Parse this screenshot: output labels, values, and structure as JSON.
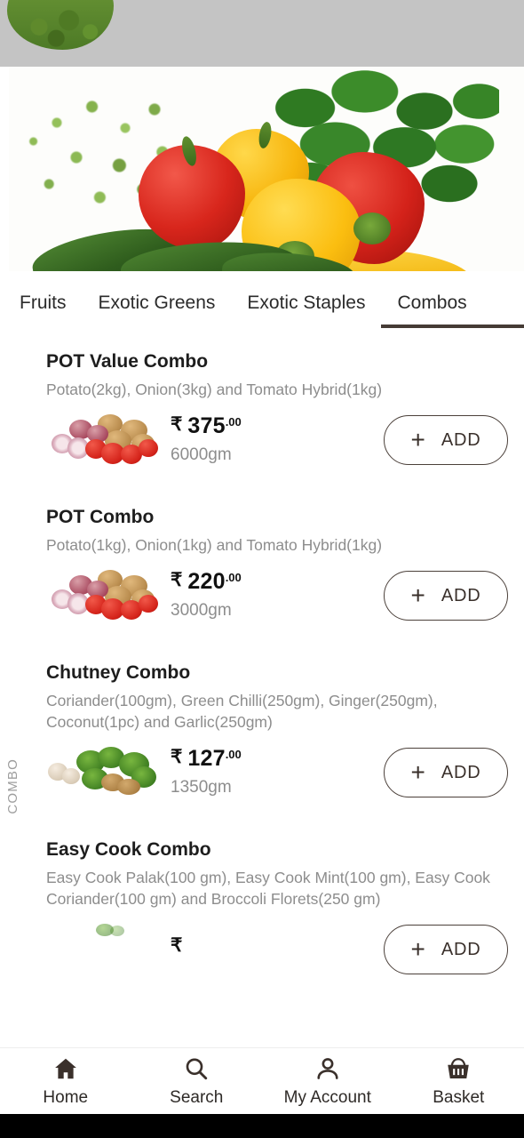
{
  "status_band": {
    "overlay_color": "#c4c4c4",
    "decoration_icon": "broccoli-image"
  },
  "banner": {
    "alt": "fresh-vegetables-banner",
    "items": "red and yellow bell peppers, cucumbers, basil, parsley"
  },
  "tabs": {
    "items": [
      {
        "label": "Fruits",
        "active": false
      },
      {
        "label": "Exotic Greens",
        "active": false
      },
      {
        "label": "Exotic Staples",
        "active": false
      },
      {
        "label": "Combos",
        "active": true
      }
    ],
    "indicator_color": "#453b35"
  },
  "side_label": "COMBO",
  "products": [
    {
      "title": "POT Value Combo",
      "description": "Potato(2kg), Onion(3kg) and Tomato Hybrid(1kg)",
      "currency": "₹",
      "price": "375",
      "price_decimals": ".00",
      "weight": "6000gm",
      "add_label": "ADD",
      "add_plus": "+",
      "thumb": "potato-onion-tomato-image"
    },
    {
      "title": "POT Combo",
      "description": "Potato(1kg), Onion(1kg) and Tomato Hybrid(1kg)",
      "currency": "₹",
      "price": "220",
      "price_decimals": ".00",
      "weight": "3000gm",
      "add_label": "ADD",
      "add_plus": "+",
      "thumb": "potato-onion-tomato-image"
    },
    {
      "title": "Chutney Combo",
      "description": "Coriander(100gm), Green Chilli(250gm), Ginger(250gm), Coconut(1pc) and Garlic(250gm)",
      "currency": "₹",
      "price": "127",
      "price_decimals": ".00",
      "weight": "1350gm",
      "add_label": "ADD",
      "add_plus": "+",
      "thumb": "garlic-coriander-ginger-image"
    },
    {
      "title": "Easy Cook Combo",
      "description": "Easy Cook Palak(100 gm), Easy Cook Mint(100 gm), Easy Cook Coriander(100 gm) and Broccoli Florets(250 gm)",
      "currency": "₹",
      "price": "",
      "price_decimals": "",
      "weight": "",
      "add_label": "ADD",
      "add_plus": "+",
      "thumb": "greens-image"
    }
  ],
  "bottom_nav": {
    "items": [
      {
        "label": "Home",
        "icon": "home-icon"
      },
      {
        "label": "Search",
        "icon": "search-icon"
      },
      {
        "label": "My Account",
        "icon": "person-icon"
      },
      {
        "label": "Basket",
        "icon": "basket-icon"
      }
    ],
    "icon_color": "#3a302b"
  }
}
